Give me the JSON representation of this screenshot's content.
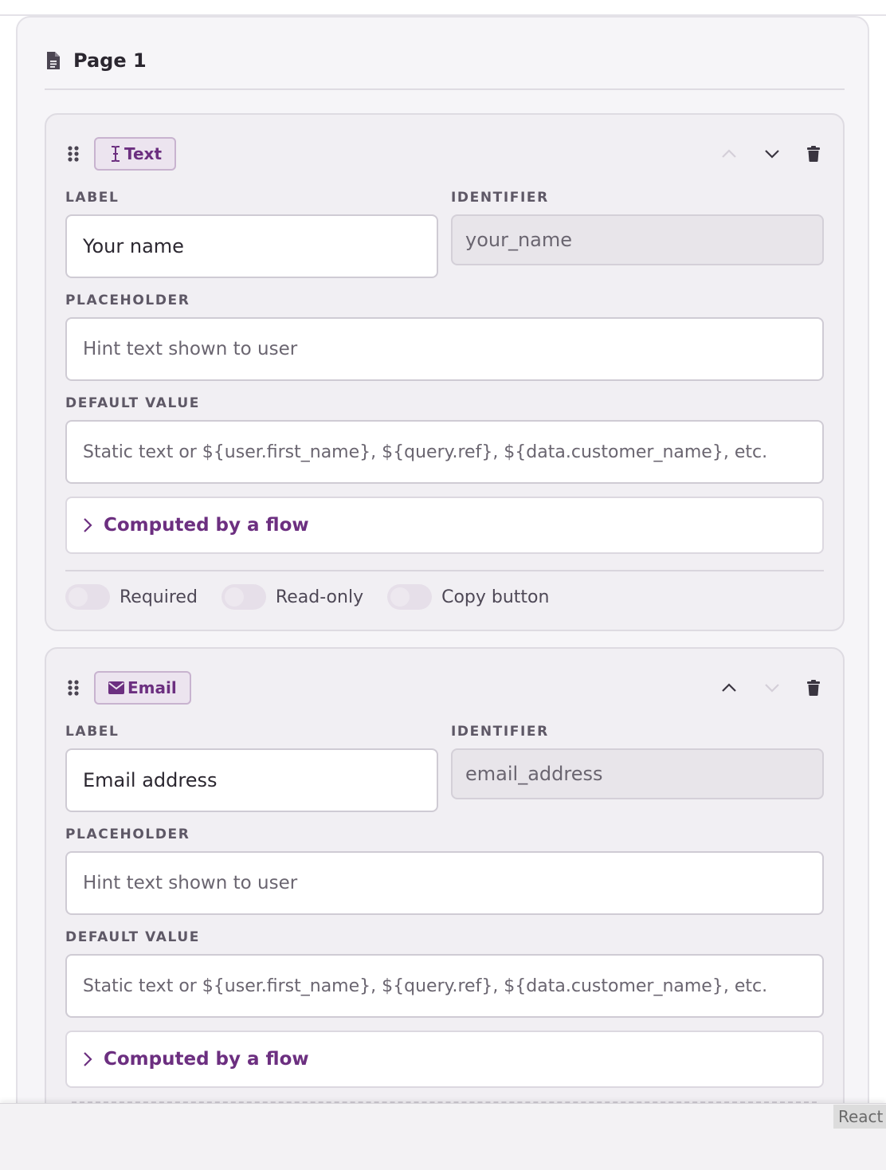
{
  "page": {
    "title": "Page 1",
    "icon": "file-text-icon"
  },
  "fields": [
    {
      "type_label": "Text",
      "type_icon": "text-cursor-icon",
      "label_heading": "LABEL",
      "label_value": "Your name",
      "identifier_heading": "IDENTIFIER",
      "identifier_value": "your_name",
      "placeholder_heading": "PLACEHOLDER",
      "placeholder_placeholder": "Hint text shown to user",
      "default_heading": "DEFAULT VALUE",
      "default_placeholder": "Static text or ${user.first_name}, ${query.ref}, ${data.customer_name}, etc.",
      "computed_label": "Computed by a flow",
      "toggles": [
        {
          "label": "Required",
          "on": false
        },
        {
          "label": "Read-only",
          "on": false
        },
        {
          "label": "Copy button",
          "on": false
        }
      ],
      "move_up_enabled": false,
      "move_down_enabled": true
    },
    {
      "type_label": "Email",
      "type_icon": "envelope-icon",
      "label_heading": "LABEL",
      "label_value": "Email address",
      "identifier_heading": "IDENTIFIER",
      "identifier_value": "email_address",
      "placeholder_heading": "PLACEHOLDER",
      "placeholder_placeholder": "Hint text shown to user",
      "default_heading": "DEFAULT VALUE",
      "default_placeholder": "Static text or ${user.first_name}, ${query.ref}, ${data.customer_name}, etc.",
      "computed_label": "Computed by a flow",
      "move_up_enabled": true,
      "move_down_enabled": false
    }
  ],
  "devtools_badge": "React D",
  "colors": {
    "accent": "#6c2f80",
    "card_bg": "#f1eff3",
    "page_bg": "#f6f5f8",
    "chip_bg": "#ece4ef",
    "readonly_bg": "#e8e5ea"
  }
}
